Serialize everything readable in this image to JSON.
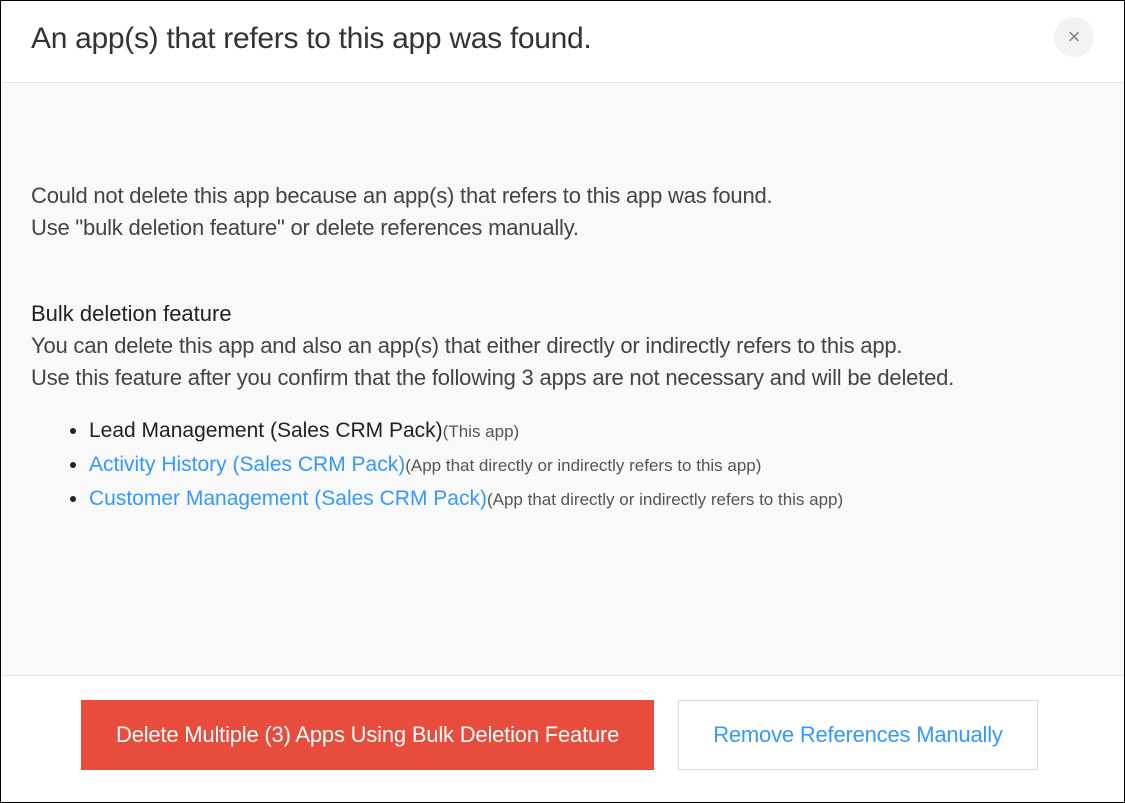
{
  "header": {
    "title": "An app(s) that refers to this app was found.",
    "close_label": "×"
  },
  "body": {
    "intro_line1": "Could not delete this app because an app(s) that refers to this app was found.",
    "intro_line2": "Use \"bulk deletion feature\" or delete references manually.",
    "bulk_heading": "Bulk deletion feature",
    "bulk_line1": "You can delete this app and also an app(s) that either directly or indirectly refers to this app.",
    "bulk_line2": "Use this feature after you confirm that the following 3 apps are not necessary and will be deleted.",
    "apps": [
      {
        "name": "Lead Management (Sales CRM Pack)",
        "note": "(This app)",
        "link": false
      },
      {
        "name": "Activity History (Sales CRM Pack)",
        "note": "(App that directly or indirectly refers to this app)",
        "link": true
      },
      {
        "name": "Customer Management (Sales CRM Pack)",
        "note": "(App that directly or indirectly refers to this app)",
        "link": true
      }
    ]
  },
  "footer": {
    "delete_label": "Delete Multiple (3) Apps Using Bulk Deletion Feature",
    "manual_label": "Remove References Manually"
  }
}
